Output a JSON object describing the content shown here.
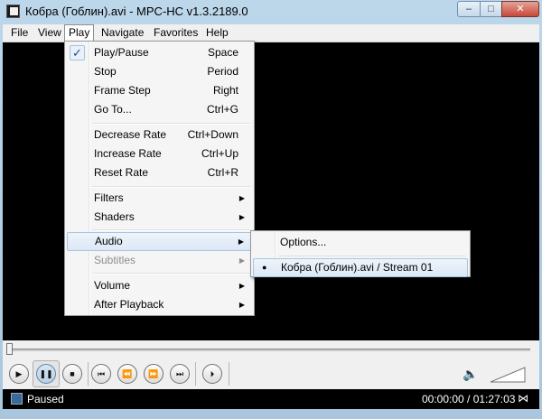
{
  "window": {
    "title": "Кобра (Гоблин).avi - MPC-HC v1.3.2189.0",
    "controls": {
      "minimize": "–",
      "maximize": "□",
      "close": "✕"
    }
  },
  "menubar": {
    "items": [
      "File",
      "View",
      "Play",
      "Navigate",
      "Favorites",
      "Help"
    ],
    "open": "Play"
  },
  "play_menu": {
    "items": [
      {
        "label": "Play/Pause",
        "shortcut": "Space",
        "checked": true
      },
      {
        "label": "Stop",
        "shortcut": "Period"
      },
      {
        "label": "Frame Step",
        "shortcut": "Right"
      },
      {
        "label": "Go To...",
        "shortcut": "Ctrl+G"
      },
      {
        "label": "Decrease Rate",
        "shortcut": "Ctrl+Down"
      },
      {
        "label": "Increase Rate",
        "shortcut": "Ctrl+Up"
      },
      {
        "label": "Reset Rate",
        "shortcut": "Ctrl+R"
      },
      {
        "label": "Filters",
        "submenu": true
      },
      {
        "label": "Shaders",
        "submenu": true
      },
      {
        "label": "Audio",
        "submenu": true,
        "highlighted": true
      },
      {
        "label": "Subtitles",
        "submenu": true,
        "disabled": true
      },
      {
        "label": "Volume",
        "submenu": true
      },
      {
        "label": "After Playback",
        "submenu": true
      }
    ],
    "check_glyph": "✓",
    "arrow_glyph": "▶"
  },
  "audio_submenu": {
    "items": [
      {
        "label": "Options..."
      },
      {
        "label": "Кобра (Гоблин).avi / Stream 01",
        "selected": true
      }
    ],
    "bullet_glyph": "●"
  },
  "toolbar": {
    "buttons": [
      "play-icon",
      "pause-icon",
      "stop-icon",
      "skip-back-icon",
      "rewind-icon",
      "fast-forward-icon",
      "skip-forward-icon",
      "frame-step-icon"
    ],
    "glyphs": {
      "play": "▶",
      "pause": "❚❚",
      "stop": "■",
      "skip_back": "⏮",
      "rewind": "⏪",
      "fast_forward": "⏩",
      "skip_forward": "⏭",
      "frame_step": "⏵"
    },
    "volume_icon": "speaker-icon",
    "speaker_glyph": "🔈"
  },
  "status": {
    "state": "Paused",
    "time": "00:00:00 / 01:27:03",
    "network_glyph": "⋈"
  },
  "colors": {
    "video_background": "#000000",
    "menu_highlight": "#dce8f5",
    "status_background": "#000000"
  }
}
